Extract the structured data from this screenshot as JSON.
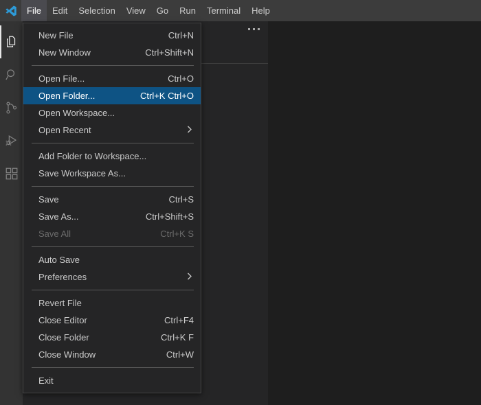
{
  "titlebar": {
    "logo_icon": "vscode-logo-icon",
    "menus": [
      {
        "label": "File",
        "active": true
      },
      {
        "label": "Edit",
        "active": false
      },
      {
        "label": "Selection",
        "active": false
      },
      {
        "label": "View",
        "active": false
      },
      {
        "label": "Go",
        "active": false
      },
      {
        "label": "Run",
        "active": false
      },
      {
        "label": "Terminal",
        "active": false
      },
      {
        "label": "Help",
        "active": false
      }
    ]
  },
  "activitybar": {
    "items": [
      {
        "name": "explorer-icon",
        "title": "Explorer",
        "active": true
      },
      {
        "name": "search-icon",
        "title": "Search",
        "active": false
      },
      {
        "name": "source-control-icon",
        "title": "Source Control",
        "active": false
      },
      {
        "name": "run-and-debug-icon",
        "title": "Run and Debug",
        "active": false
      },
      {
        "name": "extensions-icon",
        "title": "Extensions",
        "active": false
      }
    ]
  },
  "sidebar": {
    "more_actions_icon": "ellipsis-icon"
  },
  "file_menu": {
    "items": [
      {
        "type": "item",
        "label": "New File",
        "keybinding": "Ctrl+N",
        "state": "normal",
        "submenu": false
      },
      {
        "type": "item",
        "label": "New Window",
        "keybinding": "Ctrl+Shift+N",
        "state": "normal",
        "submenu": false
      },
      {
        "type": "separator"
      },
      {
        "type": "item",
        "label": "Open File...",
        "keybinding": "Ctrl+O",
        "state": "normal",
        "submenu": false
      },
      {
        "type": "item",
        "label": "Open Folder...",
        "keybinding": "Ctrl+K Ctrl+O",
        "state": "highlighted",
        "submenu": false
      },
      {
        "type": "item",
        "label": "Open Workspace...",
        "keybinding": "",
        "state": "normal",
        "submenu": false
      },
      {
        "type": "item",
        "label": "Open Recent",
        "keybinding": "",
        "state": "normal",
        "submenu": true
      },
      {
        "type": "separator"
      },
      {
        "type": "item",
        "label": "Add Folder to Workspace...",
        "keybinding": "",
        "state": "normal",
        "submenu": false
      },
      {
        "type": "item",
        "label": "Save Workspace As...",
        "keybinding": "",
        "state": "normal",
        "submenu": false
      },
      {
        "type": "separator"
      },
      {
        "type": "item",
        "label": "Save",
        "keybinding": "Ctrl+S",
        "state": "normal",
        "submenu": false
      },
      {
        "type": "item",
        "label": "Save As...",
        "keybinding": "Ctrl+Shift+S",
        "state": "normal",
        "submenu": false
      },
      {
        "type": "item",
        "label": "Save All",
        "keybinding": "Ctrl+K S",
        "state": "disabled",
        "submenu": false
      },
      {
        "type": "separator"
      },
      {
        "type": "item",
        "label": "Auto Save",
        "keybinding": "",
        "state": "normal",
        "submenu": false
      },
      {
        "type": "item",
        "label": "Preferences",
        "keybinding": "",
        "state": "normal",
        "submenu": true
      },
      {
        "type": "separator"
      },
      {
        "type": "item",
        "label": "Revert File",
        "keybinding": "",
        "state": "normal",
        "submenu": false
      },
      {
        "type": "item",
        "label": "Close Editor",
        "keybinding": "Ctrl+F4",
        "state": "normal",
        "submenu": false
      },
      {
        "type": "item",
        "label": "Close Folder",
        "keybinding": "Ctrl+K F",
        "state": "normal",
        "submenu": false
      },
      {
        "type": "item",
        "label": "Close Window",
        "keybinding": "Ctrl+W",
        "state": "normal",
        "submenu": false
      },
      {
        "type": "separator"
      },
      {
        "type": "item",
        "label": "Exit",
        "keybinding": "",
        "state": "normal",
        "submenu": false
      }
    ]
  },
  "colors": {
    "titlebar_bg": "#3c3c3c",
    "activitybar_bg": "#333333",
    "sidebar_bg": "#252526",
    "editor_bg": "#1e1e1e",
    "menu_bg": "#252526",
    "menu_border": "#454545",
    "menu_highlight": "#0e5384",
    "text": "#cccccc",
    "text_disabled": "#6b6b6b",
    "accent": "#007acc"
  }
}
